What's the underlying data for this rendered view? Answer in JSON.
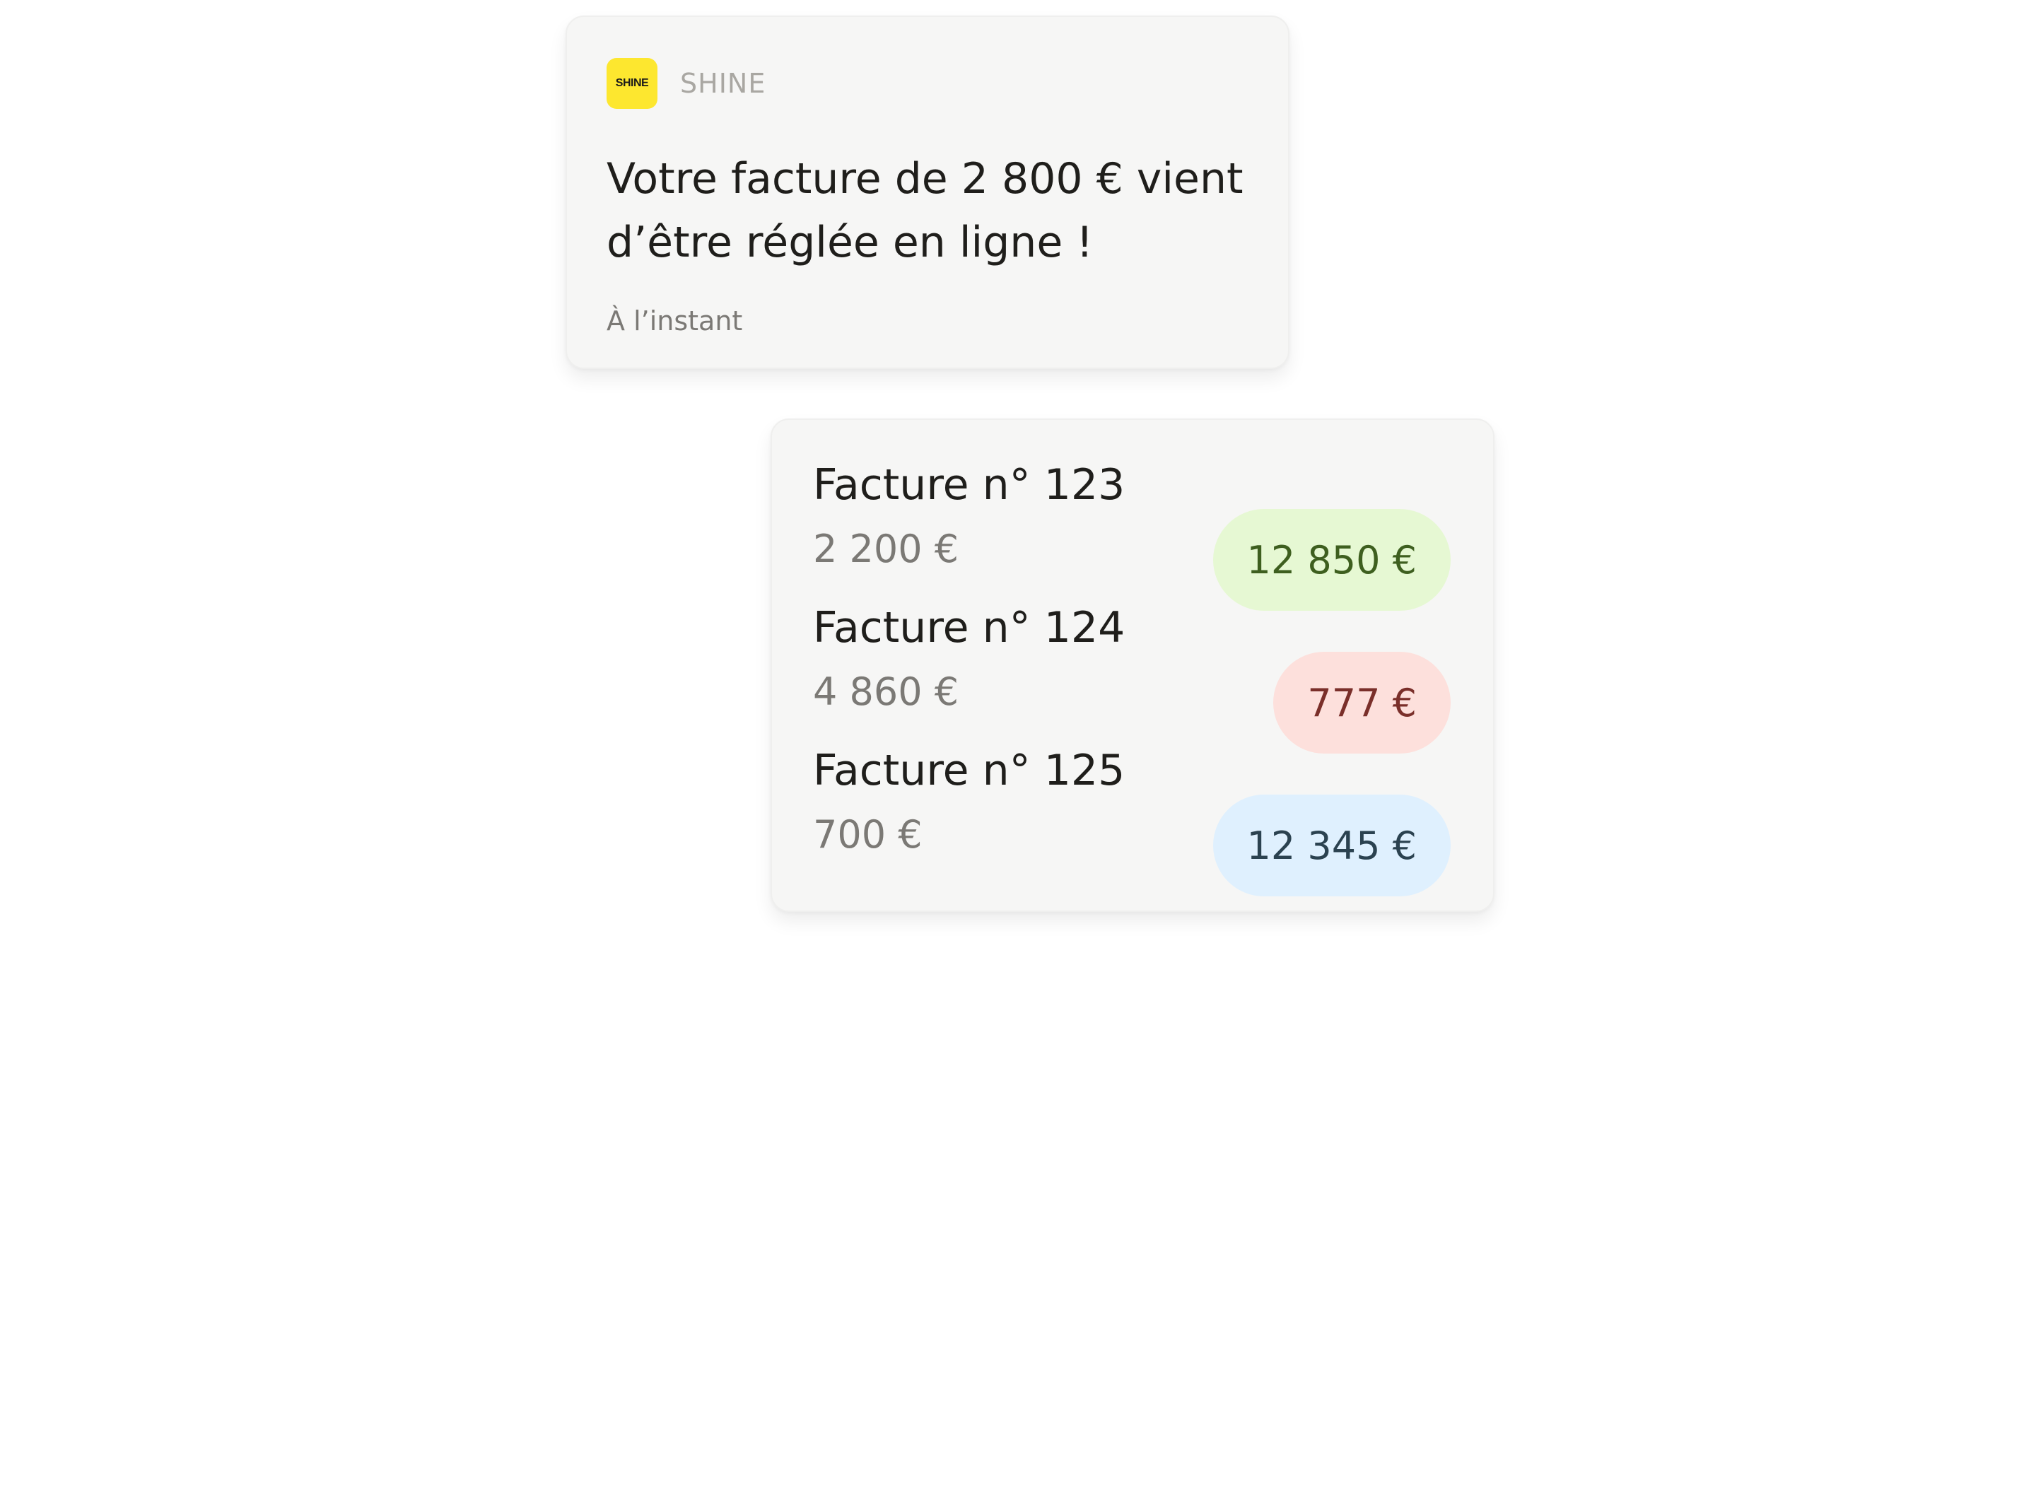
{
  "notification": {
    "logo_text": "SHINE",
    "app_name": "SHINE",
    "message": "Votre facture de 2 800 € vient d’être réglée en ligne !",
    "time": "À l’instant",
    "logo_color": "#FDE72F"
  },
  "invoices": {
    "items": [
      {
        "title": "Facture n° 123",
        "amount": "2 200 €",
        "badge": "12 850 €",
        "badge_color": "#E6F8D3"
      },
      {
        "title": "Facture n° 124",
        "amount": "4 860 €",
        "badge": "777 €",
        "badge_color": "#FDE0DC"
      },
      {
        "title": "Facture n° 125",
        "amount": "700 €",
        "badge": "12 345 €",
        "badge_color": "#DFF0FE"
      }
    ]
  }
}
